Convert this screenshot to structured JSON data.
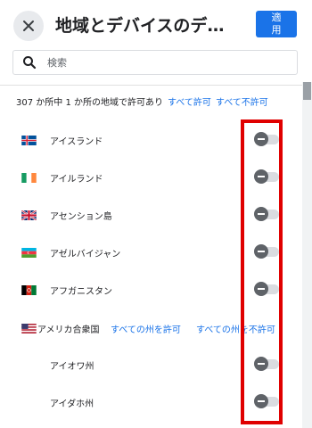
{
  "header": {
    "title": "地域とデバイスのデータ...",
    "apply_label": "適用"
  },
  "search": {
    "placeholder": "検索",
    "value": ""
  },
  "summary": {
    "text": "307 か所中 1 か所の地域で許可あり",
    "allow_all": "すべて許可",
    "disallow_all": "すべて不許可"
  },
  "regions": [
    {
      "name": "アイスランド",
      "flag": "iceland",
      "allowed": false
    },
    {
      "name": "アイルランド",
      "flag": "ireland",
      "allowed": false
    },
    {
      "name": "アセンション島",
      "flag": "uk",
      "allowed": false
    },
    {
      "name": "アゼルバイジャン",
      "flag": "azerbaijan",
      "allowed": false
    },
    {
      "name": "アフガニスタン",
      "flag": "afghanistan",
      "allowed": false
    }
  ],
  "usa": {
    "name": "アメリカ合衆国",
    "flag": "usa",
    "allow_states": "すべての州を許可",
    "disallow_states": "すべての州を不許可",
    "states": [
      {
        "name": "アイオワ州",
        "allowed": false
      },
      {
        "name": "アイダホ州",
        "allowed": false
      }
    ]
  },
  "colors": {
    "accent": "#1a73e8",
    "highlight": "#e00000",
    "toggle_knob": "#5f6368",
    "toggle_track": "#dadce0"
  }
}
